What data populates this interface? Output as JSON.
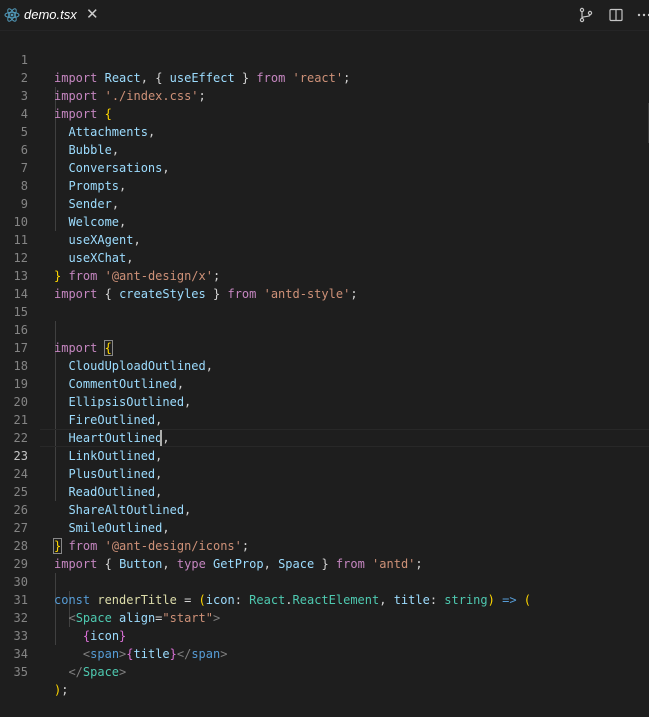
{
  "tab": {
    "filename": "demo.tsx",
    "close_glyph": "✕"
  },
  "icons": {
    "file_icon": "react-icon",
    "actions": [
      "source-control-compare-icon",
      "split-editor-icon",
      "more-actions-icon"
    ]
  },
  "colors": {
    "background": "#1e1e1e",
    "keyword": "#c586c0",
    "identifier": "#9cdcfe",
    "string": "#ce9178",
    "function": "#dcdcaa",
    "type": "#4ec9b0"
  },
  "cursor_line": 23,
  "lines": [
    {
      "n": "1"
    },
    {
      "n": "2"
    },
    {
      "n": "3"
    },
    {
      "n": "4"
    },
    {
      "n": "5"
    },
    {
      "n": "6"
    },
    {
      "n": "7"
    },
    {
      "n": "8"
    },
    {
      "n": "9"
    },
    {
      "n": "10"
    },
    {
      "n": "11"
    },
    {
      "n": "12"
    },
    {
      "n": "13"
    },
    {
      "n": "14"
    },
    {
      "n": "15"
    },
    {
      "n": "16"
    },
    {
      "n": "17"
    },
    {
      "n": "18"
    },
    {
      "n": "19"
    },
    {
      "n": "20"
    },
    {
      "n": "21"
    },
    {
      "n": "22"
    },
    {
      "n": "23"
    },
    {
      "n": "24"
    },
    {
      "n": "25"
    },
    {
      "n": "26"
    },
    {
      "n": "27"
    },
    {
      "n": "28"
    },
    {
      "n": "29"
    },
    {
      "n": "30"
    },
    {
      "n": "31"
    },
    {
      "n": "32"
    },
    {
      "n": "33"
    },
    {
      "n": "34"
    },
    {
      "n": "35"
    }
  ],
  "code": {
    "l1": {
      "import": "import",
      "react": "React",
      "comma": ",",
      "lb": "{",
      "useEffect": "useEffect",
      "rb": "}",
      "from": "from",
      "src": "'react'",
      "semi": ";"
    },
    "l2": {
      "import": "import",
      "src": "'./index.css'",
      "semi": ";"
    },
    "l3": {
      "import": "import",
      "lb": "{"
    },
    "l4": {
      "name": "Attachments",
      "comma": ","
    },
    "l5": {
      "name": "Bubble",
      "comma": ","
    },
    "l6": {
      "name": "Conversations",
      "comma": ","
    },
    "l7": {
      "name": "Prompts",
      "comma": ","
    },
    "l8": {
      "name": "Sender",
      "comma": ","
    },
    "l9": {
      "name": "Welcome",
      "comma": ","
    },
    "l10": {
      "name": "useXAgent",
      "comma": ","
    },
    "l11": {
      "name": "useXChat",
      "comma": ","
    },
    "l12": {
      "rb": "}",
      "from": "from",
      "src": "'@ant-design/x'",
      "semi": ";"
    },
    "l13": {
      "import": "import",
      "lb": "{",
      "name": "createStyles",
      "rb": "}",
      "from": "from",
      "src": "'antd-style'",
      "semi": ";"
    },
    "l16": {
      "import": "import",
      "lb": "{"
    },
    "l17": {
      "name": "CloudUploadOutlined",
      "comma": ","
    },
    "l18": {
      "name": "CommentOutlined",
      "comma": ","
    },
    "l19": {
      "name": "EllipsisOutlined",
      "comma": ","
    },
    "l20": {
      "name": "FireOutlined",
      "comma": ","
    },
    "l21": {
      "name": "HeartOutlined",
      "comma": ","
    },
    "l22": {
      "name": "LinkOutlined",
      "comma": ","
    },
    "l23": {
      "name": "PlusOutlined",
      "comma": ","
    },
    "l24": {
      "name": "ReadOutlined",
      "comma": ","
    },
    "l25": {
      "name": "ShareAltOutlined",
      "comma": ","
    },
    "l26": {
      "name": "SmileOutlined",
      "comma": ","
    },
    "l27": {
      "rb": "}",
      "from": "from",
      "src": "'@ant-design/icons'",
      "semi": ";"
    },
    "l28": {
      "import": "import",
      "lb": "{",
      "button": "Button",
      "comma1": ",",
      "type": "type",
      "getprop": "GetProp",
      "comma2": ",",
      "space": "Space",
      "rb": "}",
      "from": "from",
      "src": "'antd'",
      "semi": ";"
    },
    "l30": {
      "const": "const",
      "name": "renderTitle",
      "eq": "=",
      "lp": "(",
      "icon": "icon",
      "colon1": ":",
      "react": "React",
      "dot": ".",
      "reactel": "ReactElement",
      "comma": ",",
      "title": "title",
      "colon2": ":",
      "string": "string",
      "rp": ")",
      "arrow": "=>",
      "lp2": "("
    },
    "l31": {
      "lt": "<",
      "tag": "Space",
      "attr": "align",
      "eq": "=",
      "val": "\"start\"",
      "gt": ">"
    },
    "l32": {
      "lb": "{",
      "name": "icon",
      "rb": "}"
    },
    "l33": {
      "lt": "<",
      "tag": "span",
      "gt": ">",
      "lb": "{",
      "name": "title",
      "rb": "}",
      "lt2": "</",
      "tag2": "span",
      "gt2": ">"
    },
    "l34": {
      "lt": "</",
      "tag": "Space",
      "gt": ">"
    },
    "l35": {
      "rp": ")",
      "semi": ";"
    }
  }
}
